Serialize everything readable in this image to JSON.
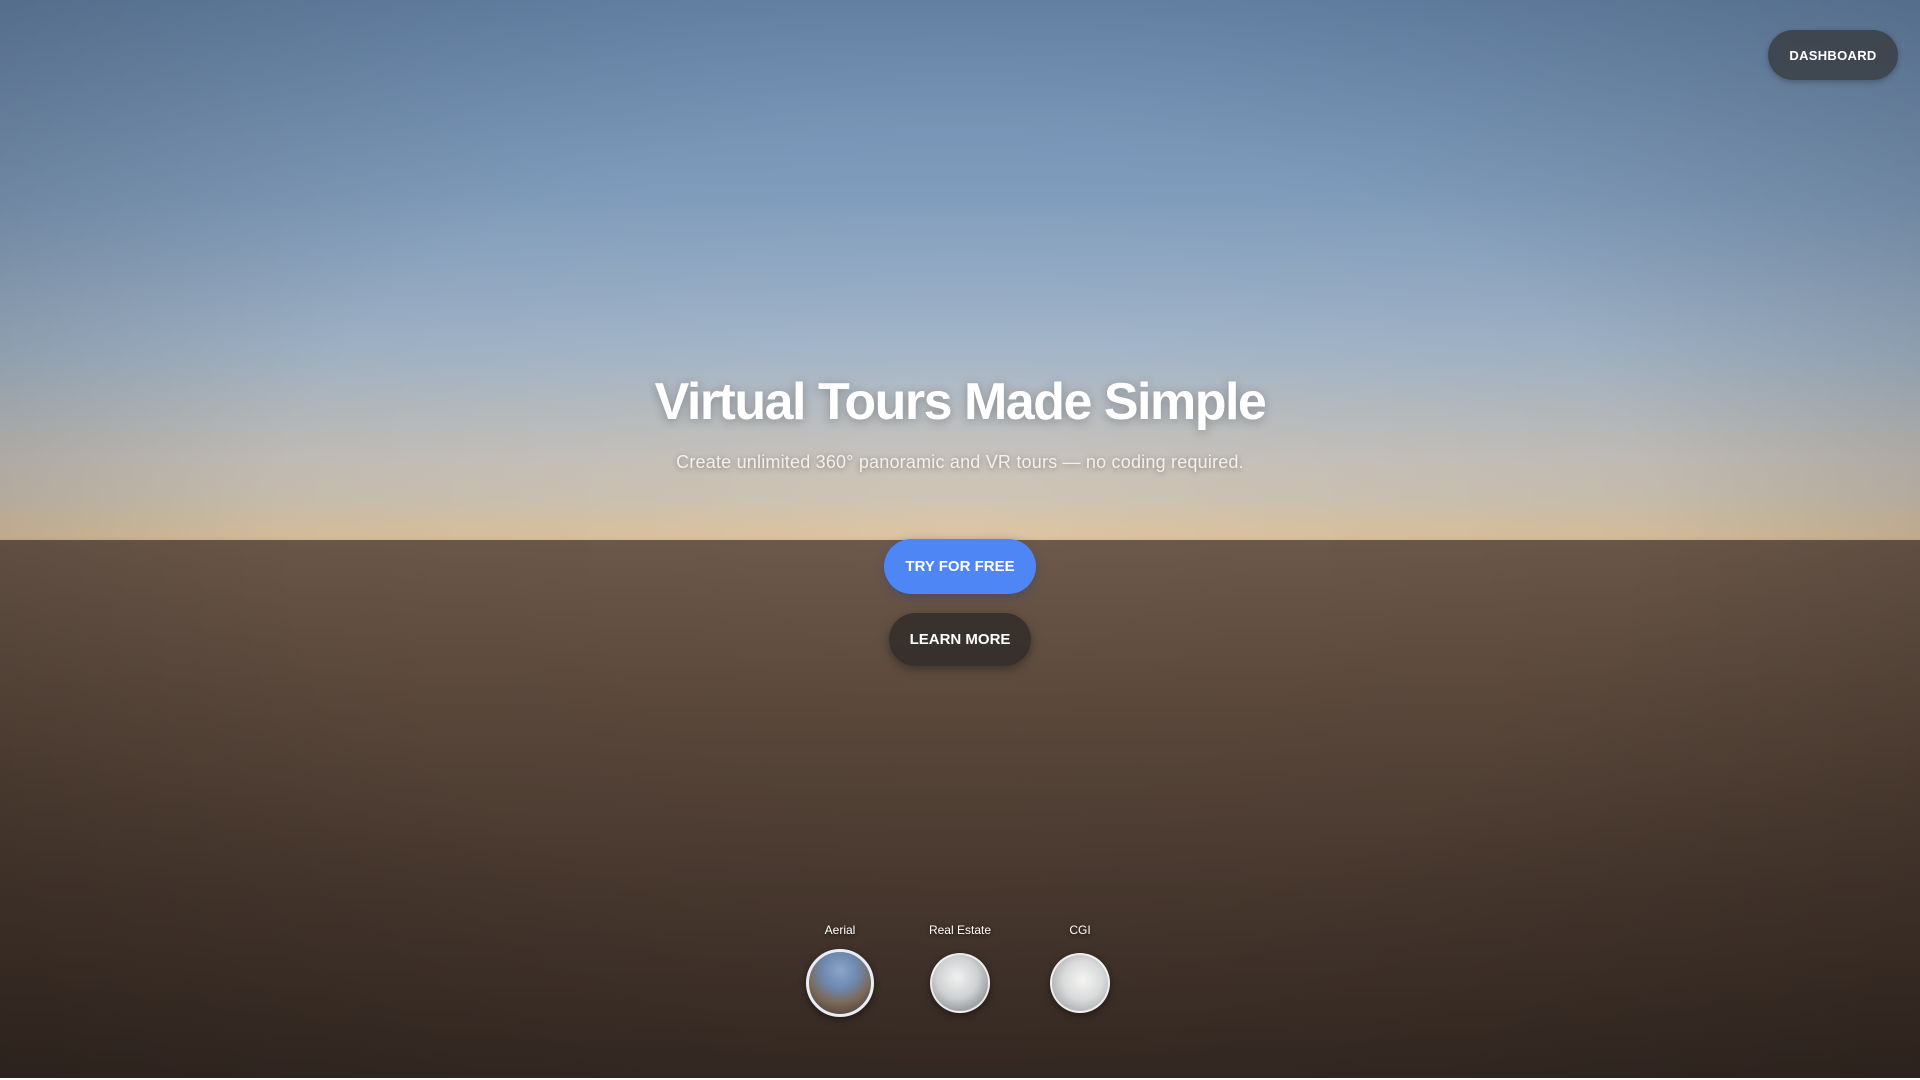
{
  "header": {
    "dashboard_label": "DASHBOARD"
  },
  "hero": {
    "title": "Virtual Tours Made Simple",
    "subtitle": "Create unlimited 360° panoramic and VR tours — no coding required.",
    "primary_cta": "TRY FOR FREE",
    "secondary_cta": "LEARN MORE"
  },
  "tours": [
    {
      "label": "Aerial",
      "active": true
    },
    {
      "label": "Real Estate",
      "active": false
    },
    {
      "label": "CGI",
      "active": false
    }
  ],
  "colors": {
    "primary_button": "#4e86f5",
    "secondary_button": "#28262480",
    "dashboard_button": "#3a3e44"
  }
}
